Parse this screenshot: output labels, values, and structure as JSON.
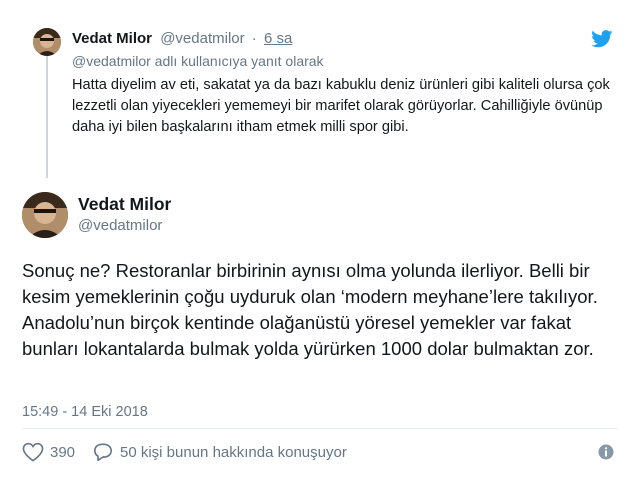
{
  "parent_tweet": {
    "name": "Vedat Milor",
    "handle": "@vedatmilor",
    "separator": "·",
    "time": "6 sa",
    "reply_to": "@vedatmilor adlı kullanıcıya yanıt olarak",
    "text": "Hatta diyelim av eti, sakatat ya da bazı kabuklu deniz ürünleri gibi kaliteli olursa çok lezzetli olan yiyecekleri yememeyi bir marifet olarak görüyorlar. Cahilliğiyle övünüp daha iyi bilen başkalarını itham etmek milli spor gibi."
  },
  "main_tweet": {
    "name": "Vedat Milor",
    "handle": "@vedatmilor",
    "text": "Sonuç ne? Restoranlar birbirinin aynısı olma yolunda ilerliyor. Belli bir kesim yemeklerinin çoğu uyduruk olan ‘modern meyhane’lere takılıyor. Anadolu’nun birçok kentinde olağanüstü yöresel yemekler var fakat bunları lokantalarda bulmak yolda yürürken 1000 dolar bulmaktan zor.",
    "timestamp": "15:49 - 14 Eki 2018"
  },
  "actions": {
    "like_count": "390",
    "reply_text": "50 kişi bunun hakkında konuşuyor"
  },
  "icons": {
    "brand": "twitter-bird-icon",
    "like": "heart-icon",
    "reply": "speech-bubble-icon",
    "info": "info-icon"
  },
  "colors": {
    "twitter_blue": "#1da1f2",
    "secondary_text": "#657786",
    "primary_text": "#14171a",
    "divider": "#e6ecf0"
  }
}
